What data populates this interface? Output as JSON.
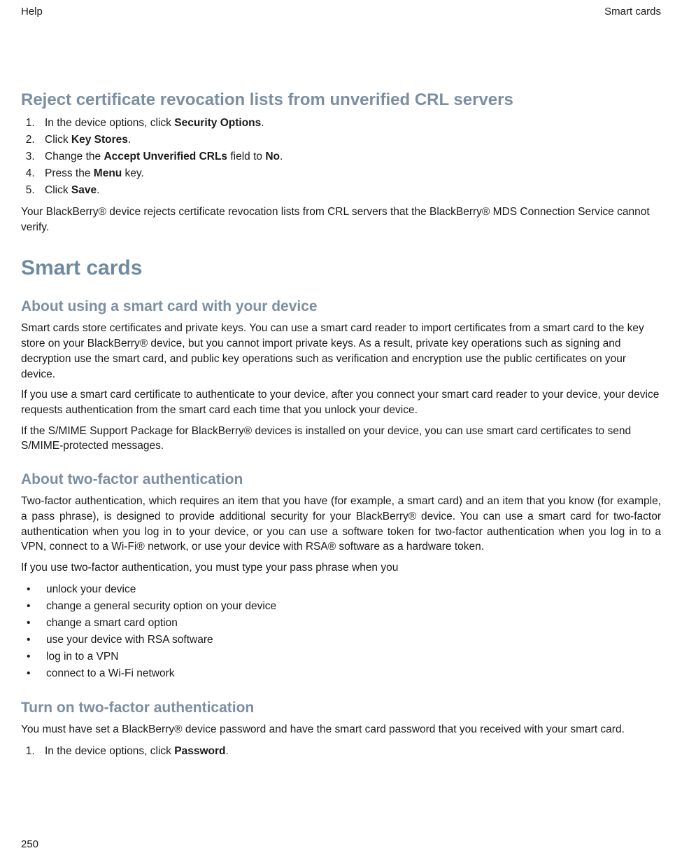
{
  "header": {
    "left": "Help",
    "right": "Smart cards"
  },
  "sec1": {
    "title": "Reject certificate revocation lists from unverified CRL servers",
    "steps": [
      {
        "pre": "In the device options, click ",
        "bold": "Security Options",
        "post": "."
      },
      {
        "pre": "Click ",
        "bold": "Key Stores",
        "post": "."
      },
      {
        "pre": "Change the ",
        "bold": "Accept Unverified CRLs",
        "mid": " field to ",
        "bold2": "No",
        "post": "."
      },
      {
        "pre": "Press the ",
        "bold": "Menu",
        "post": " key."
      },
      {
        "pre": "Click ",
        "bold": "Save",
        "post": "."
      }
    ],
    "note": "Your BlackBerry® device rejects certificate revocation lists from CRL servers that the BlackBerry® MDS Connection Service cannot verify."
  },
  "sec2": {
    "title": "Smart cards"
  },
  "sec3": {
    "title": "About using a smart card with your device",
    "p1": "Smart cards store certificates and private keys. You can use a smart card reader to import certificates from a smart card to the key store on your BlackBerry® device, but you cannot import private keys. As a result, private key operations such as signing and decryption use the smart card, and public key operations such as verification and encryption use the public certificates on your device.",
    "p2": "If you use a smart card certificate to authenticate to your device, after you connect your smart card reader to your device, your device requests authentication from the smart card each time that you unlock your device.",
    "p3": "If the S/MIME Support Package for BlackBerry® devices is installed on your device, you can use smart card certificates to send S/MIME-protected messages."
  },
  "sec4": {
    "title": "About two-factor authentication",
    "p1": "Two-factor authentication, which requires an item that you have (for example, a smart card) and an item that you know (for example, a pass phrase), is designed to provide additional security for your BlackBerry® device. You can use a smart card for two-factor authentication when you log in to your device, or you can use a software token for two-factor authentication when you log in to a VPN, connect to a Wi-Fi® network, or use your device with RSA® software as a hardware token.",
    "p2": "If you use two-factor authentication, you must type your pass phrase when you",
    "bullets": [
      "unlock your device",
      "change a general security option on your device",
      "change a smart card option",
      "use your device with RSA software",
      "log in to a VPN",
      "connect to a Wi-Fi network"
    ]
  },
  "sec5": {
    "title": "Turn on two-factor authentication",
    "p1": "You must have set a BlackBerry® device password and have the smart card password that you received with your smart card.",
    "steps": [
      {
        "pre": "In the device options, click ",
        "bold": "Password",
        "post": "."
      }
    ]
  },
  "pageNumber": "250"
}
